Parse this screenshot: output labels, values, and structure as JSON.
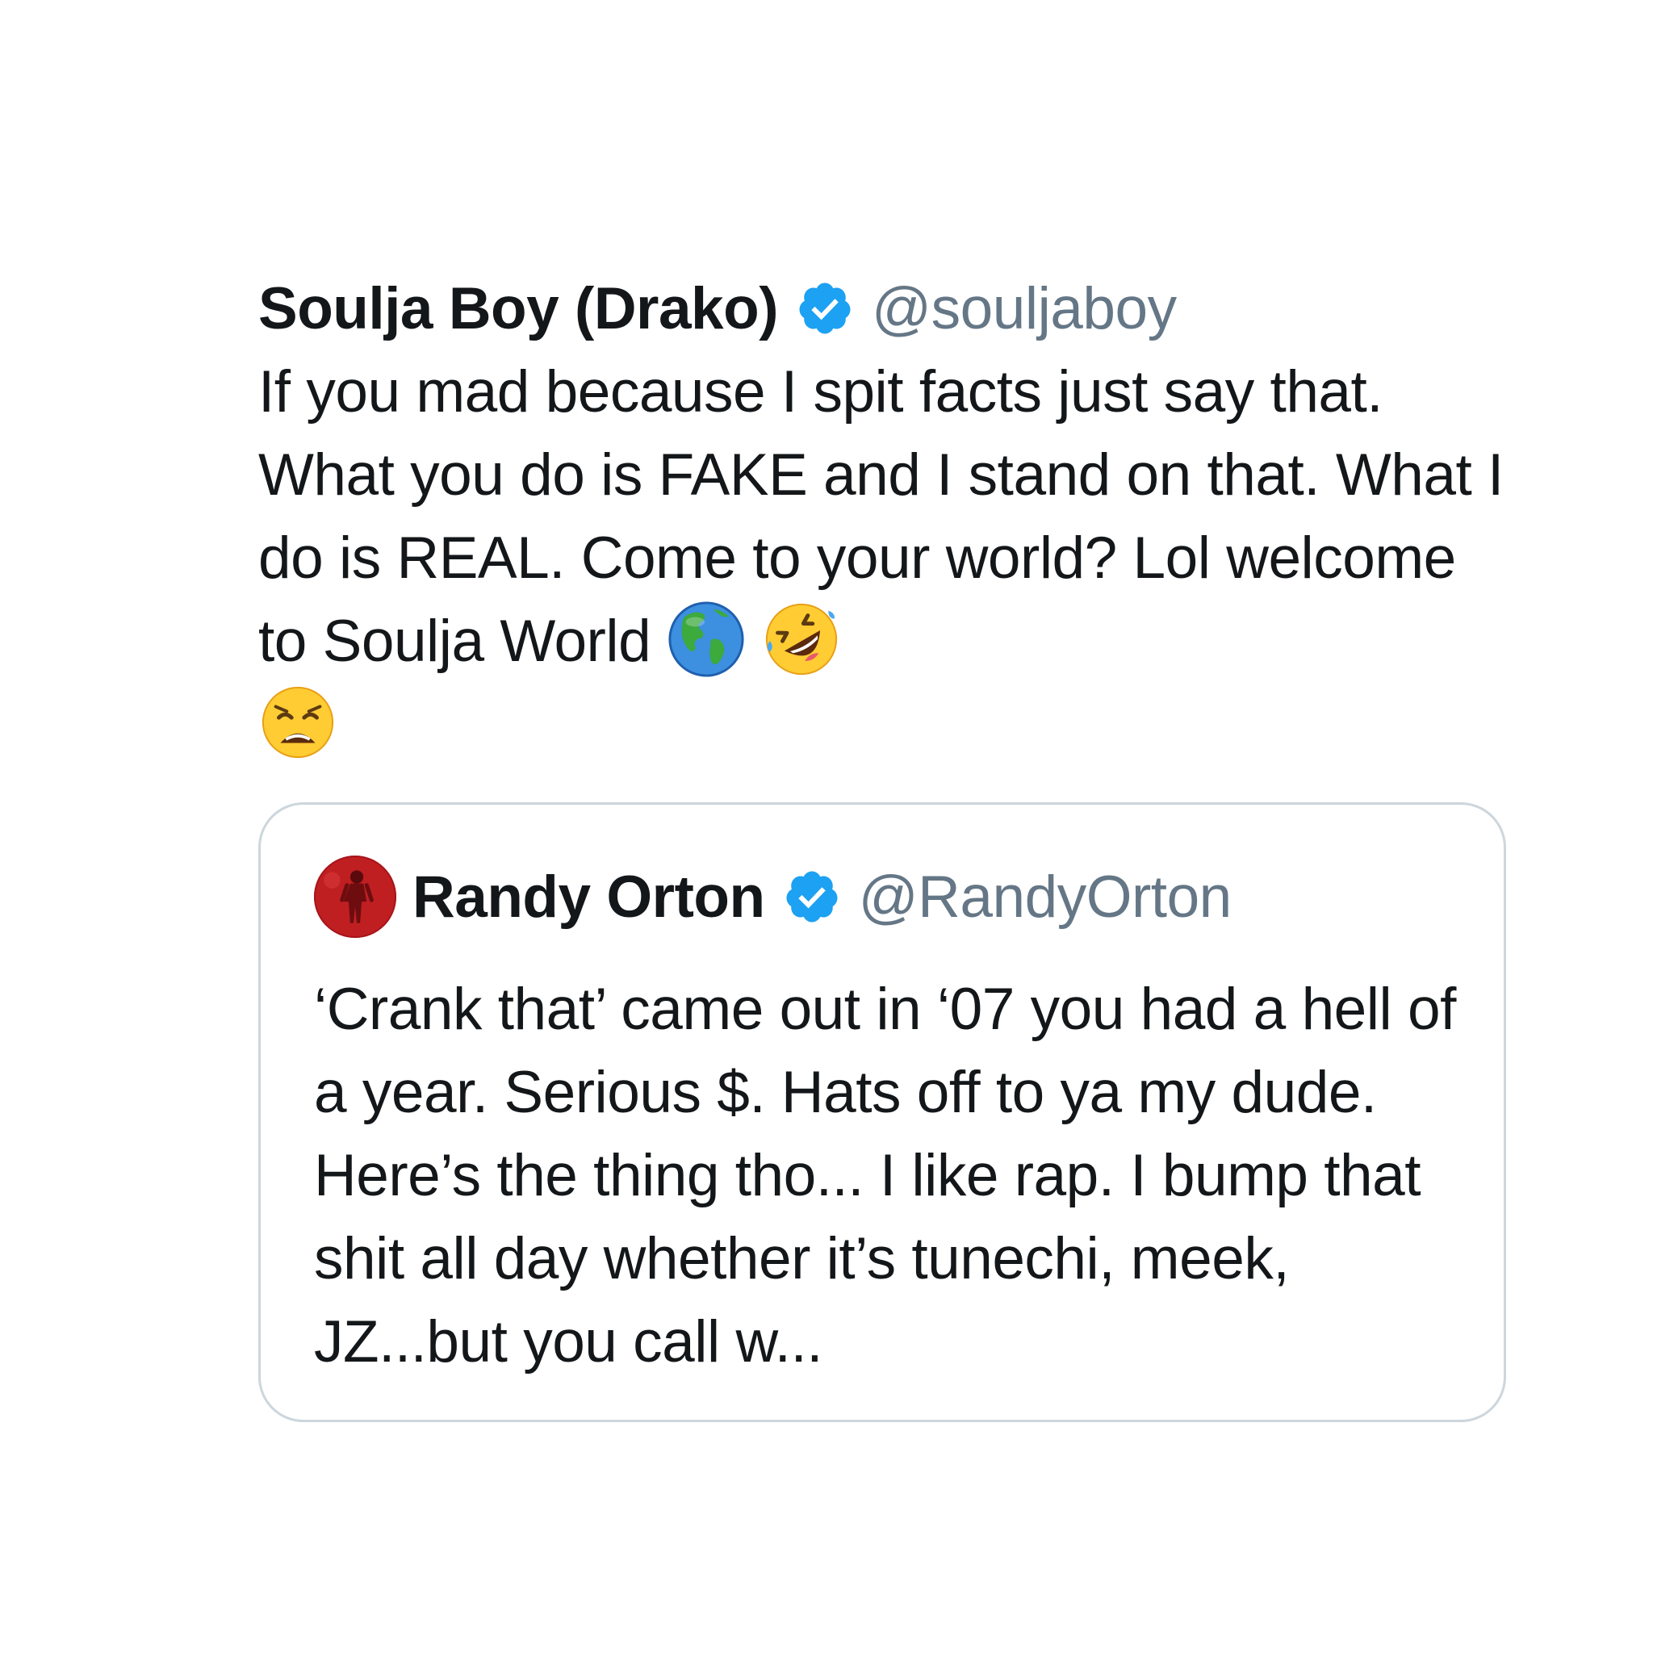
{
  "tweet": {
    "display_name": "Soulja Boy (Drako)",
    "handle": "@souljaboy",
    "verified": true,
    "text": "If you mad because I spit facts just say that. What you do is FAKE and I stand on that. What I do is REAL. Come to your world? Lol welcome to Soulja World",
    "emojis": [
      "globe-americas-emoji",
      "rolling-on-floor-laughing-emoji",
      "weary-face-emoji"
    ]
  },
  "quoted_tweet": {
    "display_name": "Randy Orton",
    "handle": "@RandyOrton",
    "verified": true,
    "avatar": "avatar-red-figure",
    "text": "‘Crank that’ came out in ‘07 you had a hell of a year. Serious $. Hats off to ya my dude. Here’s the thing tho... I like rap. I bump that shit all day whether it’s tunechi, meek, JZ...but you call w..."
  },
  "colors": {
    "text": "#14171a",
    "secondary": "#657786",
    "verified_blue": "#1da1f2",
    "border": "#ccd6dd",
    "background": "#ffffff"
  }
}
